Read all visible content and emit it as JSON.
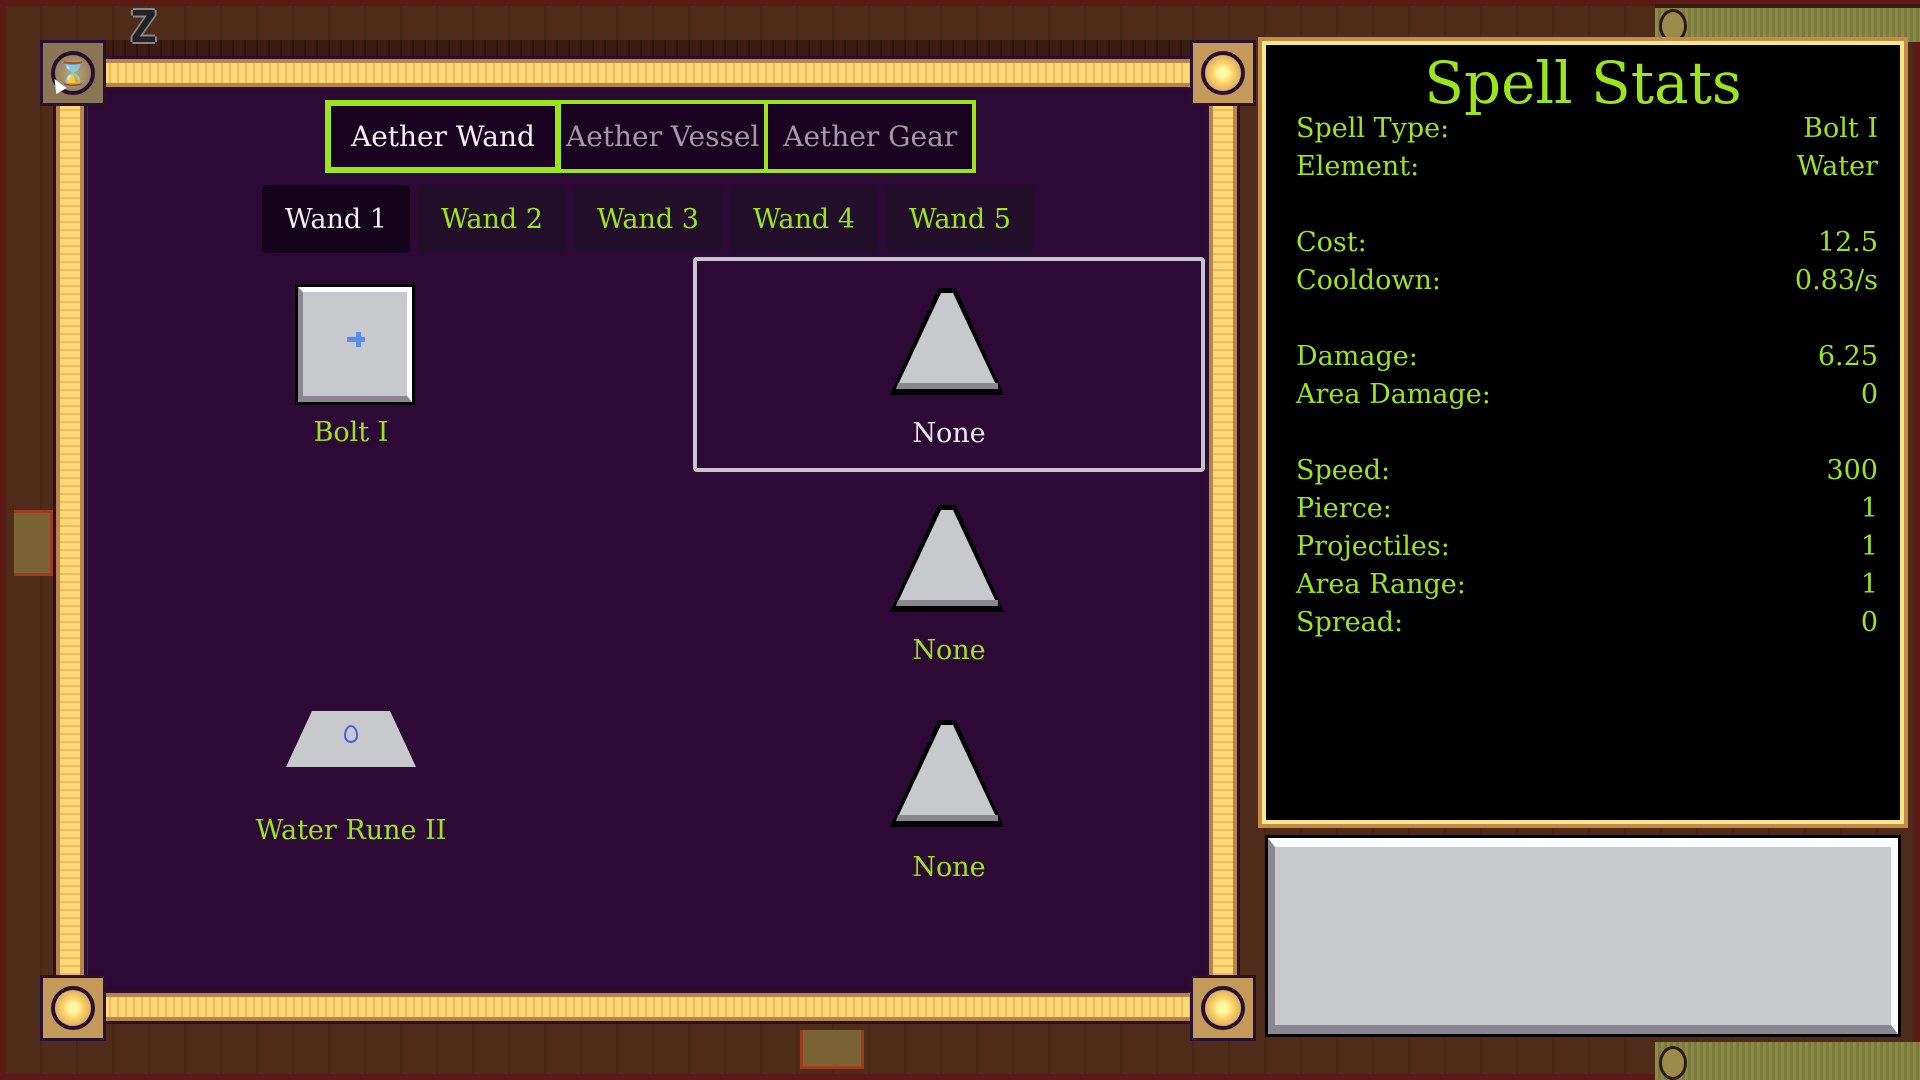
{
  "hotkey": "Z",
  "close_icon_glyph": "⌛",
  "main_tabs": [
    {
      "label": "Aether Wand",
      "active": true
    },
    {
      "label": "Aether Vessel",
      "active": false
    },
    {
      "label": "Aether Gear",
      "active": false
    }
  ],
  "wand_tabs": [
    {
      "label": "Wand 1",
      "active": true
    },
    {
      "label": "Wand 2",
      "active": false
    },
    {
      "label": "Wand 3",
      "active": false
    },
    {
      "label": "Wand 4",
      "active": false
    },
    {
      "label": "Wand 5",
      "active": false
    }
  ],
  "left_slots": {
    "spell": {
      "label": "Bolt I",
      "icon": "bolt-icon"
    },
    "rune": {
      "label": "Water Rune II",
      "icon": "water-drop-icon"
    }
  },
  "right_slots": [
    {
      "label": "None",
      "selected": true
    },
    {
      "label": "None",
      "selected": false
    },
    {
      "label": "None",
      "selected": false
    }
  ],
  "stats": {
    "title": "Spell Stats",
    "rows": [
      {
        "label": "Spell Type:",
        "value": "Bolt I"
      },
      {
        "label": "Element:",
        "value": "Water"
      },
      {
        "label": "Cost:",
        "value": "12.5"
      },
      {
        "label": "Cooldown:",
        "value": "0.83/s"
      },
      {
        "label": "Damage:",
        "value": "6.25"
      },
      {
        "label": "Area Damage:",
        "value": "0"
      },
      {
        "label": "Speed:",
        "value": "300"
      },
      {
        "label": "Pierce:",
        "value": "1"
      },
      {
        "label": "Projectiles:",
        "value": "1"
      },
      {
        "label": "Area Range:",
        "value": "1"
      },
      {
        "label": "Spread:",
        "value": "0"
      }
    ]
  },
  "colors": {
    "accent_green": "#9be51b",
    "panel_purple": "#2d0a36",
    "gold": "#ffd26a"
  }
}
